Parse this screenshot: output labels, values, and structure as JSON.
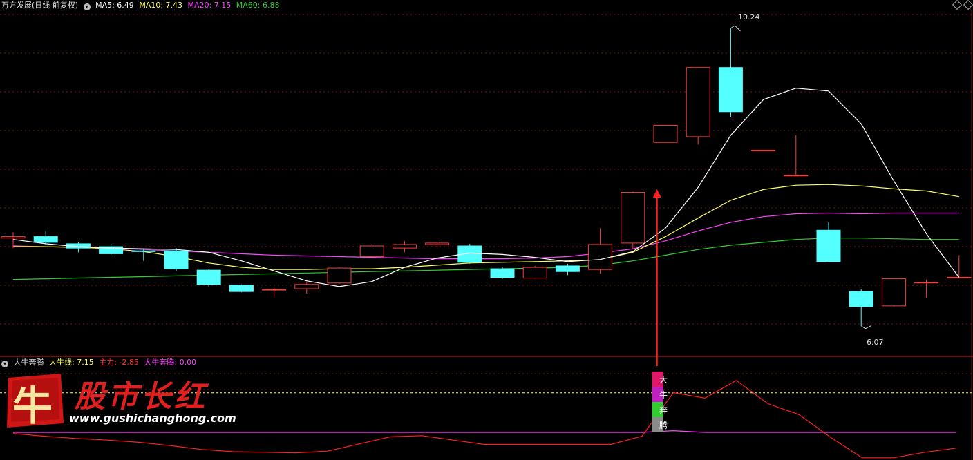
{
  "main_header": {
    "title": "万方发展(日线 前复权)",
    "ma5": "MA5: 6.49",
    "ma10": "MA10: 7.43",
    "ma20": "MA20: 7.15",
    "ma60": "MA60: 6.88"
  },
  "sub_header": {
    "title": "大牛奔腾",
    "dnx": "大牛线: 7.15",
    "zhuli": "主力: -2.85",
    "dnbt": "大牛奔腾: 0.00"
  },
  "logo": {
    "icon_char": "牛",
    "title": "股市长红",
    "url": "www.gushichanghong.com"
  },
  "signal_chars": [
    "大",
    "牛",
    "奔",
    "腾"
  ],
  "annotations": {
    "high": "10.24",
    "low": "6.07"
  },
  "colors": {
    "up": "#ff3b3b",
    "down": "#54ffff",
    "ma5": "#ffffff",
    "ma10": "#ffff66",
    "ma20": "#ff44ff",
    "ma60": "#33cc33",
    "zhuli": "#ff2020"
  },
  "chart_data": [
    {
      "type": "candlestick",
      "ylim": [
        5.7,
        10.5
      ],
      "candles": [
        {
          "o": 7.3,
          "h": 7.38,
          "l": 7.16,
          "c": 7.32
        },
        {
          "o": 7.32,
          "h": 7.4,
          "l": 7.2,
          "c": 7.24
        },
        {
          "o": 7.22,
          "h": 7.24,
          "l": 7.1,
          "c": 7.16
        },
        {
          "o": 7.18,
          "h": 7.22,
          "l": 7.06,
          "c": 7.08
        },
        {
          "o": 7.12,
          "h": 7.14,
          "l": 6.98,
          "c": 7.11
        },
        {
          "o": 7.12,
          "h": 7.16,
          "l": 6.84,
          "c": 6.87
        },
        {
          "o": 6.85,
          "h": 6.86,
          "l": 6.62,
          "c": 6.65
        },
        {
          "o": 6.64,
          "h": 6.65,
          "l": 6.54,
          "c": 6.55
        },
        {
          "o": 6.58,
          "h": 6.6,
          "l": 6.47,
          "c": 6.58
        },
        {
          "o": 6.59,
          "h": 6.69,
          "l": 6.52,
          "c": 6.65
        },
        {
          "o": 6.67,
          "h": 6.89,
          "l": 6.66,
          "c": 6.88
        },
        {
          "o": 7.04,
          "h": 7.22,
          "l": 7.04,
          "c": 7.19
        },
        {
          "o": 7.16,
          "h": 7.26,
          "l": 7.1,
          "c": 7.21
        },
        {
          "o": 7.21,
          "h": 7.25,
          "l": 7.17,
          "c": 7.23
        },
        {
          "o": 7.19,
          "h": 7.22,
          "l": 6.94,
          "c": 6.96
        },
        {
          "o": 6.87,
          "h": 6.89,
          "l": 6.73,
          "c": 6.75
        },
        {
          "o": 6.74,
          "h": 6.91,
          "l": 6.73,
          "c": 6.89
        },
        {
          "o": 6.91,
          "h": 6.94,
          "l": 6.78,
          "c": 6.83
        },
        {
          "o": 6.86,
          "h": 7.44,
          "l": 6.8,
          "c": 7.21
        },
        {
          "o": 7.23,
          "h": 7.95,
          "l": 7.14,
          "c": 7.94
        },
        {
          "o": 8.64,
          "h": 8.88,
          "l": 8.64,
          "c": 8.88
        },
        {
          "o": 8.72,
          "h": 9.69,
          "l": 8.61,
          "c": 9.69
        },
        {
          "o": 9.69,
          "h": 10.24,
          "l": 9.0,
          "c": 9.07
        },
        {
          "o": 8.53,
          "h": 8.53,
          "l": 8.53,
          "c": 8.53
        },
        {
          "o": 8.18,
          "h": 8.74,
          "l": 8.17,
          "c": 8.18
        },
        {
          "o": 7.41,
          "h": 7.52,
          "l": 6.96,
          "c": 6.97
        },
        {
          "o": 6.55,
          "h": 6.58,
          "l": 6.07,
          "c": 6.34
        },
        {
          "o": 6.35,
          "h": 6.67,
          "l": 6.34,
          "c": 6.73
        },
        {
          "o": 6.68,
          "h": 6.72,
          "l": 6.46,
          "c": 6.68
        },
        {
          "o": 6.75,
          "h": 7.06,
          "l": 6.75,
          "c": 6.75
        }
      ],
      "ma5": [
        7.28,
        7.22,
        7.18,
        7.16,
        7.15,
        7.14,
        7.1,
        6.98,
        6.84,
        6.7,
        6.62,
        6.69,
        6.89,
        7.02,
        7.09,
        7.07,
        7.03,
        6.97,
        7.0,
        7.11,
        7.44,
        8.01,
        8.74,
        9.24,
        9.4,
        9.36,
        8.9,
        8.1,
        7.36,
        6.75
      ],
      "ma10": [
        7.18,
        7.18,
        7.17,
        7.15,
        7.11,
        7.04,
        6.95,
        6.89,
        6.86,
        6.86,
        6.87,
        6.87,
        6.89,
        6.92,
        6.95,
        6.96,
        6.97,
        6.98,
        7.0,
        7.1,
        7.32,
        7.58,
        7.83,
        7.98,
        8.04,
        8.05,
        8.03,
        7.99,
        7.96,
        7.88
      ],
      "ma20": [
        7.19,
        7.18,
        7.17,
        7.16,
        7.14,
        7.12,
        7.1,
        7.08,
        7.06,
        7.05,
        7.04,
        7.03,
        7.02,
        7.01,
        7.01,
        7.01,
        7.02,
        7.04,
        7.09,
        7.15,
        7.26,
        7.4,
        7.52,
        7.6,
        7.64,
        7.65,
        7.64,
        7.65,
        7.65,
        7.65
      ],
      "ma60": [
        6.72,
        6.73,
        6.74,
        6.75,
        6.76,
        6.77,
        6.78,
        6.79,
        6.8,
        6.81,
        6.82,
        6.83,
        6.84,
        6.85,
        6.86,
        6.87,
        6.88,
        6.89,
        6.92,
        6.98,
        7.06,
        7.14,
        7.2,
        7.24,
        7.28,
        7.3,
        7.3,
        7.29,
        7.28,
        7.28
      ],
      "annotated_high": 10.24,
      "annotated_low": 6.07
    },
    {
      "type": "line",
      "title": "大牛奔腾",
      "ylim": [
        -5,
        12
      ],
      "dnx": 7.15,
      "zhuli": [
        -0.2,
        -0.7,
        -1.1,
        -1.4,
        -1.8,
        -2.4,
        -3.1,
        -3.5,
        -3.6,
        -3.7,
        -3.4,
        -2.1,
        -0.8,
        -0.6,
        -1.4,
        -2.2,
        -2.2,
        -2.2,
        -2.2,
        -2.2,
        -0.7,
        7.2,
        6.2,
        9.4,
        5.2,
        3.2,
        -0.9,
        -4.6,
        -4.6,
        -3.6,
        -2.85
      ],
      "dnbt": [
        0,
        0,
        0,
        0,
        0,
        0,
        0,
        0,
        0,
        0,
        0,
        0,
        0,
        0,
        0,
        0,
        0,
        0,
        0,
        0,
        0,
        0.3,
        0,
        0,
        0,
        0,
        0,
        0,
        0,
        0,
        0
      ],
      "signal_index": 20.5
    }
  ]
}
